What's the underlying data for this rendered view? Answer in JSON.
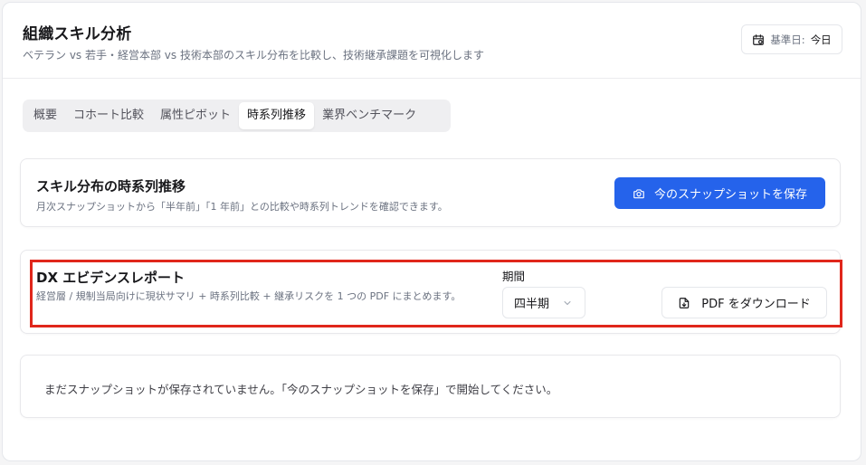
{
  "header": {
    "title": "組織スキル分析",
    "subtitle": "ベテラン vs 若手・経営本部 vs 技術本部のスキル分布を比較し、技術継承課題を可視化します",
    "date_label": "基準日:",
    "date_value": "今日"
  },
  "tabs": [
    {
      "label": "概要",
      "active": false
    },
    {
      "label": "コホート比較",
      "active": false
    },
    {
      "label": "属性ピボット",
      "active": false
    },
    {
      "label": "時系列推移",
      "active": true
    },
    {
      "label": "業界ベンチマーク",
      "active": false
    }
  ],
  "trend_panel": {
    "title": "スキル分布の時系列推移",
    "description": "月次スナップショットから「半年前」「1 年前」との比較や時系列トレンドを確認できます。",
    "save_button": "今のスナップショットを保存"
  },
  "report_panel": {
    "title": "DX エビデンスレポート",
    "description": "経営層 / 規制当局向けに現状サマリ + 時系列比較 + 継承リスクを 1 つの PDF にまとめます。",
    "period_label": "期間",
    "period_value": "四半期",
    "download_button": "PDF をダウンロード"
  },
  "empty_panel": {
    "message": "まだスナップショットが保存されていません。「今のスナップショットを保存」で開始してください。"
  },
  "icons": {
    "date": "calendar-icon",
    "save": "camera-icon",
    "select": "chevron-down-icon",
    "download": "file-download-icon"
  },
  "colors": {
    "primary": "#2563eb",
    "highlight": "#e0261b"
  }
}
